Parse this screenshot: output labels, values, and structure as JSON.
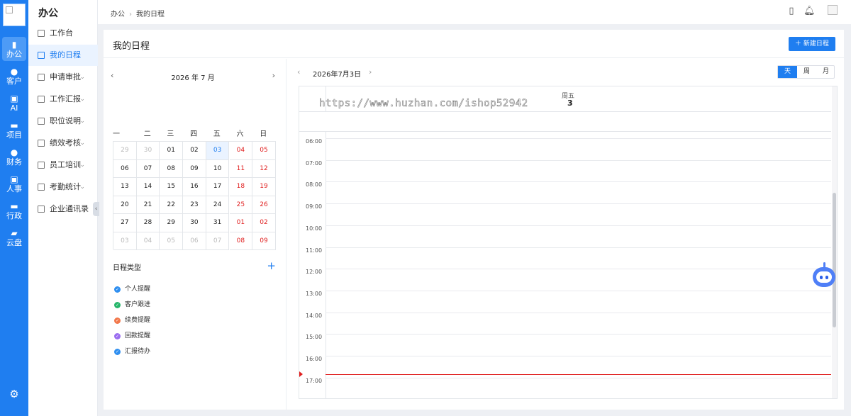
{
  "rail": {
    "items": [
      {
        "icon": "chart-bars-icon",
        "glyph": "▮",
        "label": "办公",
        "active": true
      },
      {
        "icon": "person-icon",
        "glyph": "●",
        "label": "客户"
      },
      {
        "icon": "ai-icon",
        "glyph": "▣",
        "label": "AI"
      },
      {
        "icon": "folder-icon",
        "glyph": "▬",
        "label": "项目"
      },
      {
        "icon": "money-bag-icon",
        "glyph": "●",
        "label": "财务"
      },
      {
        "icon": "id-badge-icon",
        "glyph": "▣",
        "label": "人事"
      },
      {
        "icon": "briefcase-icon",
        "glyph": "▬",
        "label": "行政"
      },
      {
        "icon": "cloud-disk-icon",
        "glyph": "▰",
        "label": "云盘"
      }
    ],
    "bottom_icon": "settings-icon"
  },
  "menu": {
    "title": "办公",
    "items": [
      {
        "label": "工作台",
        "has_children": false
      },
      {
        "label": "我的日程",
        "has_children": false,
        "active": true
      },
      {
        "label": "申请审批",
        "has_children": true
      },
      {
        "label": "工作汇报",
        "has_children": true
      },
      {
        "label": "职位说明",
        "has_children": true
      },
      {
        "label": "绩效考核",
        "has_children": true
      },
      {
        "label": "员工培训",
        "has_children": true
      },
      {
        "label": "考勤统计",
        "has_children": true
      },
      {
        "label": "企业通讯录",
        "has_children": false
      }
    ]
  },
  "breadcrumb": {
    "root": "办公",
    "current": "我的日程"
  },
  "page": {
    "title": "我的日程",
    "new_button": "新建日程"
  },
  "mini_calendar": {
    "title": "2026 年 7 月",
    "weekdays": [
      "一",
      "二",
      "三",
      "四",
      "五",
      "六",
      "日"
    ],
    "weeks": [
      [
        "29",
        "30",
        "01",
        "02",
        "03",
        "04",
        "05"
      ],
      [
        "06",
        "07",
        "08",
        "09",
        "10",
        "11",
        "12"
      ],
      [
        "13",
        "14",
        "15",
        "16",
        "17",
        "18",
        "19"
      ],
      [
        "20",
        "21",
        "22",
        "23",
        "24",
        "25",
        "26"
      ],
      [
        "27",
        "28",
        "29",
        "30",
        "31",
        "01",
        "02"
      ],
      [
        "03",
        "04",
        "05",
        "06",
        "07",
        "08",
        "09"
      ]
    ],
    "muted": [
      [
        0,
        0
      ],
      [
        0,
        1
      ],
      [
        5,
        0
      ],
      [
        5,
        1
      ],
      [
        5,
        2
      ],
      [
        5,
        3
      ],
      [
        5,
        4
      ]
    ],
    "today": [
      0,
      4
    ]
  },
  "schedule_types": {
    "title": "日程类型",
    "items": [
      {
        "label": "个人提醒",
        "color": "#2f8ff0"
      },
      {
        "label": "客户跟进",
        "color": "#27b66b"
      },
      {
        "label": "续费提醒",
        "color": "#f2784b"
      },
      {
        "label": "回款提醒",
        "color": "#9b6ef0"
      },
      {
        "label": "汇报待办",
        "color": "#2f8ff0"
      }
    ]
  },
  "day_view": {
    "date_title": "2026年7月3日",
    "weekday": "周五",
    "day_number": "3",
    "views": [
      "天",
      "周",
      "月"
    ],
    "active_view": "天",
    "hours": [
      "06:00",
      "07:00",
      "08:00",
      "09:00",
      "10:00",
      "11:00",
      "12:00",
      "13:00",
      "14:00",
      "15:00",
      "16:00",
      "17:00"
    ]
  },
  "watermark_url": "https://www.huzhan.com/ishop52942",
  "colors": {
    "primary": "#1f7ef0",
    "weekend": "#e02020",
    "now_line": "#e02020"
  }
}
